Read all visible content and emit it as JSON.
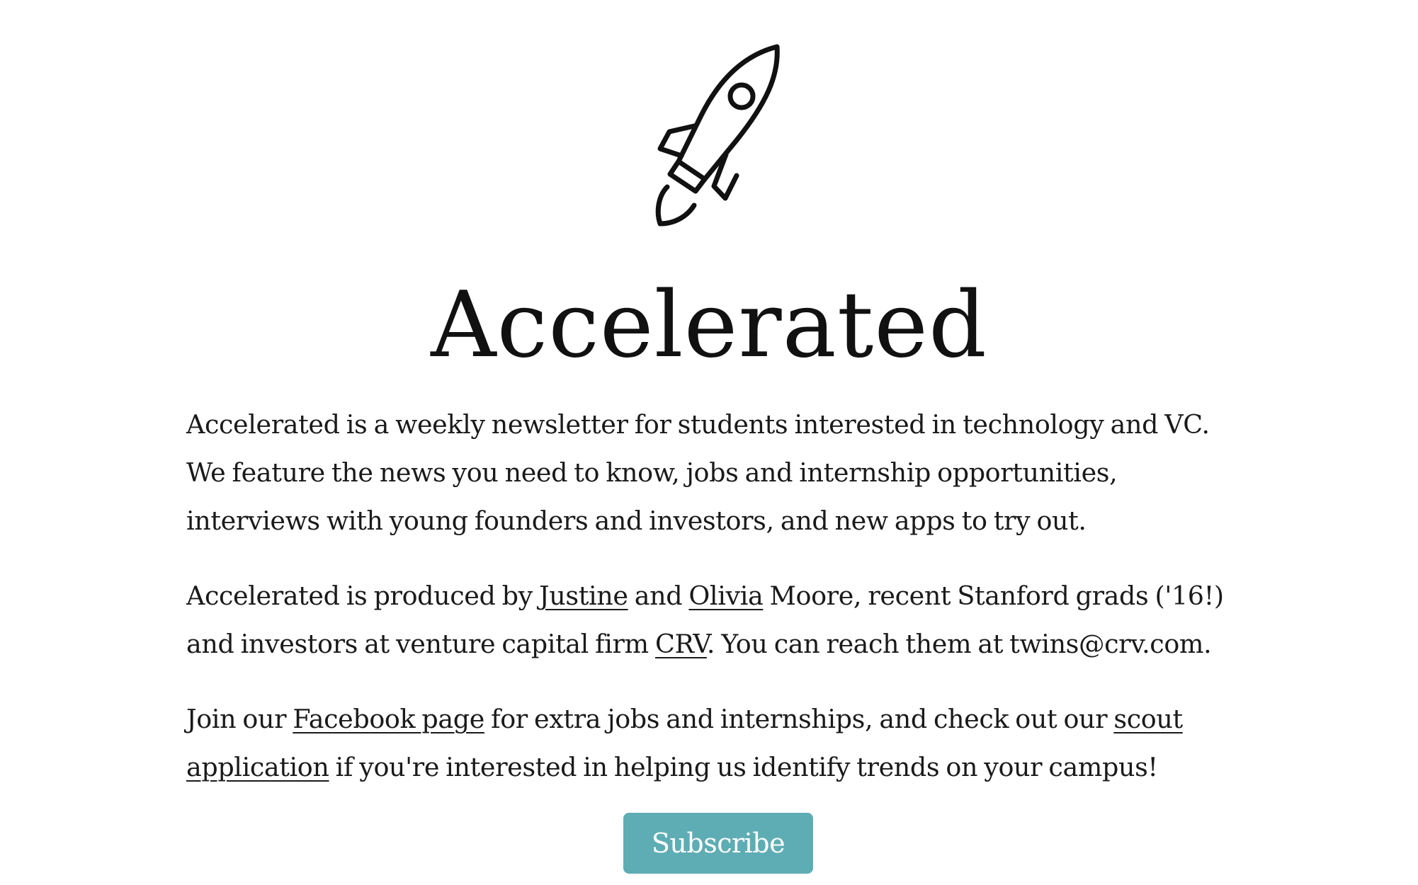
{
  "header": {
    "logo_icon": "rocket-icon",
    "title": "Accelerated"
  },
  "about": {
    "p1": "Accelerated is a weekly newsletter for students interested in technology and VC. We feature the news you need to know, jobs and internship opportunities, interviews with young founders and investors, and new apps to try out.",
    "p2": {
      "t1": "Accelerated is produced by ",
      "link_justine": "Justine",
      "t2": " and ",
      "link_olivia": "Olivia",
      "t3": " Moore, recent Stanford grads ('16!) and investors at venture capital firm ",
      "link_crv": "CRV",
      "t4": ". You can reach them at twins@crv.com."
    },
    "p3": {
      "t1": "Join our ",
      "link_facebook": "Facebook page",
      "t2": " for extra jobs and internships, and check out our ",
      "link_scout": "scout application",
      "t3": " if you're interested in helping us identify trends on your campus!"
    }
  },
  "cta": {
    "subscribe_label": "Subscribe",
    "button_color": "#5fadb4"
  }
}
